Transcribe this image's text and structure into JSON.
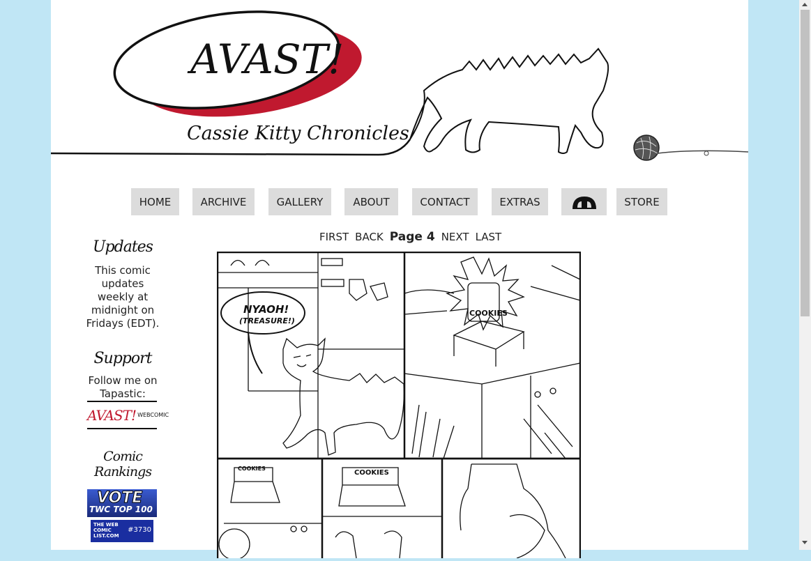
{
  "site": {
    "logo_title": "AVAST!",
    "logo_subtitle": "Cassie Kitty Chronicles",
    "accent": "#c0192f",
    "page_bg": "#c0e6f5"
  },
  "nav": {
    "items": [
      {
        "label": "HOME"
      },
      {
        "label": "ARCHIVE"
      },
      {
        "label": "GALLERY"
      },
      {
        "label": "ABOUT"
      },
      {
        "label": "CONTACT"
      },
      {
        "label": "EXTRAS"
      },
      {
        "label": "",
        "icon": "deviantart-icon"
      },
      {
        "label": "STORE"
      }
    ]
  },
  "pager": {
    "first": "FIRST",
    "back": "BACK",
    "current": "Page 4",
    "next": "NEXT",
    "last": "LAST"
  },
  "sidebar": {
    "updates_heading": "Updates",
    "updates_text": "This comic updates weekly at midnight on Fridays (EDT).",
    "support_heading": "Support",
    "support_text": "Follow me on Tapastic:",
    "tapastic_banner_title": "AVAST!",
    "tapastic_banner_sub": "WEBCOMIC",
    "rankings_heading": "Comic Rankings",
    "vote_banner_top": "VOTE",
    "vote_banner_bottom": "TWC TOP 100",
    "twcl_banner": "THE WEB COMIC LIST.COM",
    "twcl_rank": "#3730"
  },
  "comic": {
    "speech_main": "NYAOH!",
    "speech_sub": "(TREASURE!)",
    "jar_label": "COOKIES",
    "jar_label_2": "COOKIES",
    "jar_label_3": "COOKIES"
  }
}
